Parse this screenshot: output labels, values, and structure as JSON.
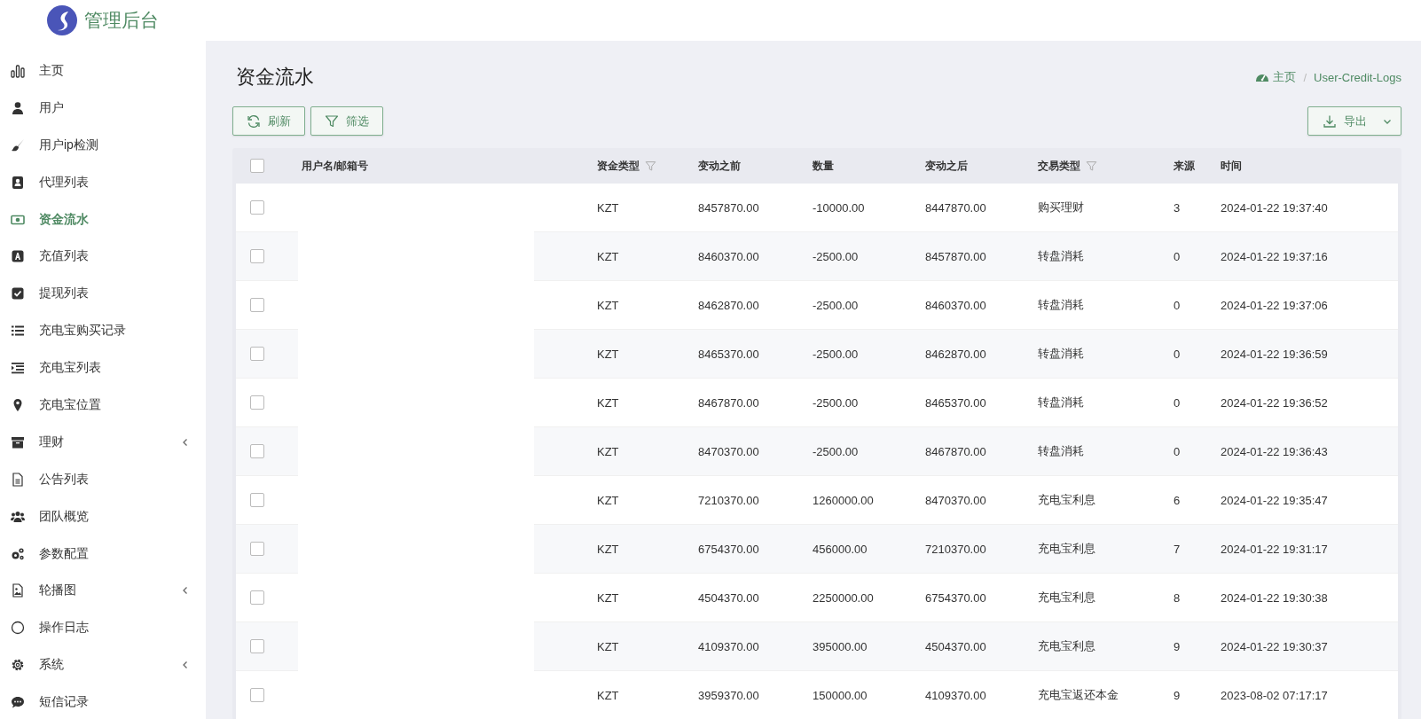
{
  "app": {
    "title": "管理后台"
  },
  "sidebar": {
    "items": [
      {
        "label": "主页",
        "selected": false,
        "kind": "link"
      },
      {
        "label": "用户",
        "selected": false,
        "kind": "link"
      },
      {
        "label": "用户ip检测",
        "selected": false,
        "kind": "link"
      },
      {
        "label": "代理列表",
        "selected": false,
        "kind": "link"
      },
      {
        "label": "资金流水",
        "selected": true,
        "kind": "link"
      },
      {
        "label": "充值列表",
        "selected": false,
        "kind": "link"
      },
      {
        "label": "提现列表",
        "selected": false,
        "kind": "link"
      },
      {
        "label": "充电宝购买记录",
        "selected": false,
        "kind": "link"
      },
      {
        "label": "充电宝列表",
        "selected": false,
        "kind": "link"
      },
      {
        "label": "充电宝位置",
        "selected": false,
        "kind": "link"
      },
      {
        "label": "理财",
        "selected": false,
        "kind": "group"
      },
      {
        "label": "公告列表",
        "selected": false,
        "kind": "link"
      },
      {
        "label": "团队概览",
        "selected": false,
        "kind": "link"
      },
      {
        "label": "参数配置",
        "selected": false,
        "kind": "link"
      },
      {
        "label": "轮播图",
        "selected": false,
        "kind": "group"
      },
      {
        "label": "操作日志",
        "selected": false,
        "kind": "link"
      },
      {
        "label": "系统",
        "selected": false,
        "kind": "group"
      },
      {
        "label": "短信记录",
        "selected": false,
        "kind": "link"
      }
    ]
  },
  "page": {
    "title": "资金流水",
    "breadcrumb_separator": "/",
    "breadcrumb": [
      {
        "label": "主页"
      },
      {
        "label": "User-Credit-Logs"
      }
    ]
  },
  "toolbar": {
    "buttons": [
      {
        "label": "刷新",
        "kind": "refresh"
      },
      {
        "label": "筛选",
        "kind": "filter"
      }
    ],
    "export": {
      "label": "导出"
    }
  },
  "table": {
    "all_checked": false,
    "columns": [
      {
        "label": "用户名/邮箱号",
        "filterable": false
      },
      {
        "label": "资金类型",
        "filterable": true
      },
      {
        "label": "变动之前",
        "filterable": false
      },
      {
        "label": "数量",
        "filterable": false
      },
      {
        "label": "变动之后",
        "filterable": false
      },
      {
        "label": "交易类型",
        "filterable": true
      },
      {
        "label": "来源",
        "filterable": false
      },
      {
        "label": "时间",
        "filterable": false
      }
    ],
    "rows": [
      {
        "checked": false,
        "currency": "KZT",
        "before": "8457870.00",
        "amount": "-10000.00",
        "after": "8447870.00",
        "type": "购买理财",
        "source": "3",
        "time": "2024-01-22 19:37:40"
      },
      {
        "checked": false,
        "currency": "KZT",
        "before": "8460370.00",
        "amount": "-2500.00",
        "after": "8457870.00",
        "type": "转盘消耗",
        "source": "0",
        "time": "2024-01-22 19:37:16"
      },
      {
        "checked": false,
        "currency": "KZT",
        "before": "8462870.00",
        "amount": "-2500.00",
        "after": "8460370.00",
        "type": "转盘消耗",
        "source": "0",
        "time": "2024-01-22 19:37:06"
      },
      {
        "checked": false,
        "currency": "KZT",
        "before": "8465370.00",
        "amount": "-2500.00",
        "after": "8462870.00",
        "type": "转盘消耗",
        "source": "0",
        "time": "2024-01-22 19:36:59"
      },
      {
        "checked": false,
        "currency": "KZT",
        "before": "8467870.00",
        "amount": "-2500.00",
        "after": "8465370.00",
        "type": "转盘消耗",
        "source": "0",
        "time": "2024-01-22 19:36:52"
      },
      {
        "checked": false,
        "currency": "KZT",
        "before": "8470370.00",
        "amount": "-2500.00",
        "after": "8467870.00",
        "type": "转盘消耗",
        "source": "0",
        "time": "2024-01-22 19:36:43"
      },
      {
        "checked": false,
        "currency": "KZT",
        "before": "7210370.00",
        "amount": "1260000.00",
        "after": "8470370.00",
        "type": "充电宝利息",
        "source": "6",
        "time": "2024-01-22 19:35:47"
      },
      {
        "checked": false,
        "currency": "KZT",
        "before": "6754370.00",
        "amount": "456000.00",
        "after": "7210370.00",
        "type": "充电宝利息",
        "source": "7",
        "time": "2024-01-22 19:31:17"
      },
      {
        "checked": false,
        "currency": "KZT",
        "before": "4504370.00",
        "amount": "2250000.00",
        "after": "6754370.00",
        "type": "充电宝利息",
        "source": "8",
        "time": "2024-01-22 19:30:38"
      },
      {
        "checked": false,
        "currency": "KZT",
        "before": "4109370.00",
        "amount": "395000.00",
        "after": "4504370.00",
        "type": "充电宝利息",
        "source": "9",
        "time": "2024-01-22 19:30:37"
      },
      {
        "checked": false,
        "currency": "KZT",
        "before": "3959370.00",
        "amount": "150000.00",
        "after": "4109370.00",
        "type": "充电宝返还本金",
        "source": "9",
        "time": "2023-08-02 07:17:17"
      }
    ]
  }
}
